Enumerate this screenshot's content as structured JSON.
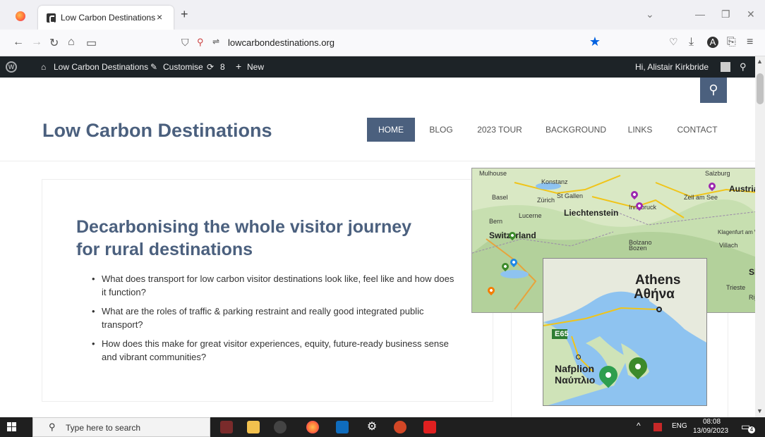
{
  "browser": {
    "tab_title": "Low Carbon Destinations",
    "tab_close": "×",
    "new_tab": "+",
    "url": "lowcarbondestinations.org"
  },
  "admin_bar": {
    "site_name": "Low Carbon Destinations",
    "customise": "Customise",
    "updates_count": "8",
    "new_label": "New",
    "greeting": "Hi, Alistair Kirkbride"
  },
  "site": {
    "title": "Low Carbon Destinations",
    "menu": [
      "HOME",
      "BLOG",
      "2023 TOUR",
      "BACKGROUND",
      "LINKS",
      "CONTACT"
    ],
    "active_menu": "HOME"
  },
  "content": {
    "heading": "Decarbonising the whole visitor journey for rural destinations",
    "bullets": [
      "What does transport for low carbon visitor destinations look like, feel like and how does it function?",
      "What are the roles of traffic & parking restraint and really good integrated public transport?",
      "How does this make for great visitor experiences, equity, future-ready business sense and vibrant communities?"
    ]
  },
  "map_alps": {
    "labels": [
      "Mulhouse",
      "Konstanz",
      "Basel",
      "Zürich",
      "St Gallen",
      "Lucerne",
      "Bern",
      "Liechtenstein",
      "Switzerland",
      "Innsbruck",
      "Salzburg",
      "Austria",
      "Zell am See",
      "Bolzano",
      "Bozen",
      "Villach",
      "Klagenfurt am Wörthersee",
      "Slov",
      "Trieste",
      "Rijeka"
    ]
  },
  "map_greece": {
    "labels": [
      "Athens",
      "Αθήνα",
      "E65",
      "Nafplion",
      "Ναύπλιο"
    ]
  },
  "taskbar": {
    "search_placeholder": "Type here to search",
    "language": "ENG",
    "time": "08:08",
    "date": "13/09/2023",
    "notification_count": "4"
  },
  "colors": {
    "brand": "#4b607e",
    "admin_bar": "#1d2327",
    "pin_green": "#3c8a2a",
    "pin_purple": "#9c27b0",
    "pin_blue": "#1e88e5",
    "pin_orange": "#f57c00"
  }
}
